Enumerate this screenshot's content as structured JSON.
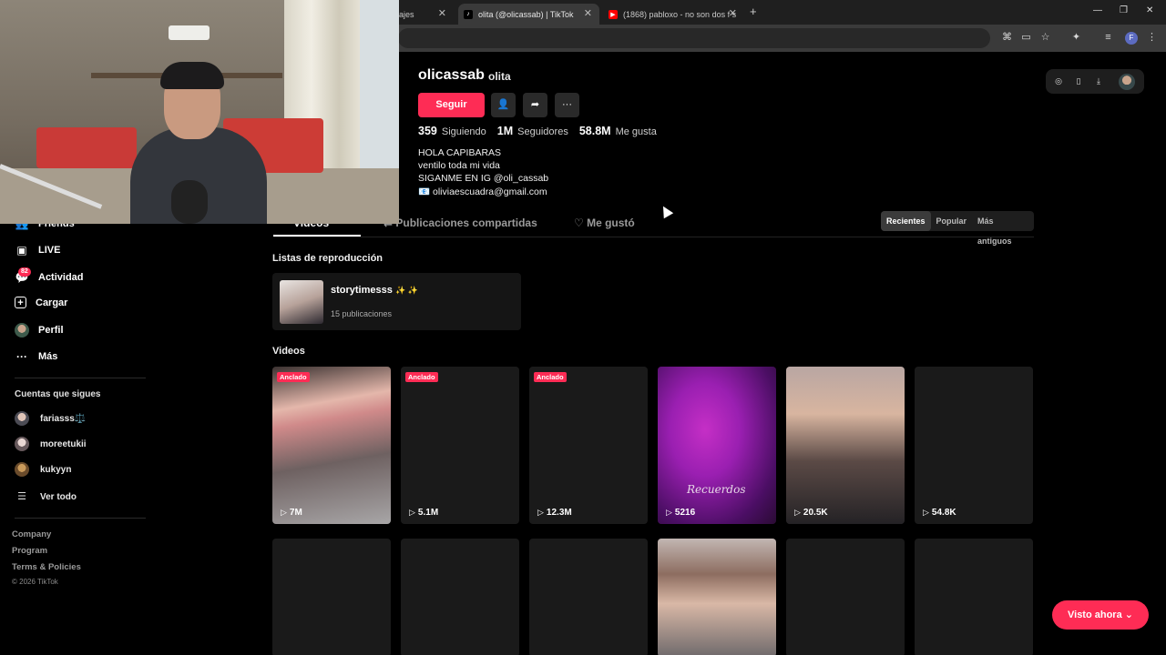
{
  "browser": {
    "tabs": [
      {
        "label": "ajes",
        "active": false
      },
      {
        "label": "olita (@olicassab) | TikTok",
        "active": true
      },
      {
        "label": "(1868) pabloxo - no son dos f s",
        "active": false
      }
    ],
    "close_glyph": "✕",
    "new_tab_glyph": "+"
  },
  "sidebar": {
    "items": [
      {
        "label": "Friends",
        "icon": "friends-icon"
      },
      {
        "label": "LIVE",
        "icon": "live-icon"
      },
      {
        "label": "Actividad",
        "icon": "activity-icon",
        "badge": "82"
      },
      {
        "label": "Cargar",
        "icon": "upload-icon"
      },
      {
        "label": "Perfil",
        "icon": "profile-avatar-icon"
      },
      {
        "label": "Más",
        "icon": "more-icon"
      }
    ],
    "following_heading": "Cuentas que sigues",
    "following": [
      {
        "name": "fariasss⚖️"
      },
      {
        "name": "moreetukii"
      },
      {
        "name": "kukyyn"
      }
    ],
    "see_all": "Ver todo",
    "footer_links": [
      "Company",
      "Program",
      "Terms & Policies"
    ],
    "copyright": "© 2026 TikTok"
  },
  "profile": {
    "username": "olicassab",
    "nickname": "olita",
    "follow_button": "Seguir",
    "stats": [
      {
        "value": "359",
        "label": "Siguiendo"
      },
      {
        "value": "1M",
        "label": "Seguidores"
      },
      {
        "value": "58.8M",
        "label": "Me gusta"
      }
    ],
    "bio": [
      "HOLA CAPIBARAS",
      "ventilo toda mi vida",
      "SIGANME EN IG @oli_cassab",
      "📧 oliviaescuadra@gmail.com"
    ]
  },
  "tabs": {
    "items": [
      "Videos",
      "Publicaciones compartidas",
      "Me gustó"
    ],
    "sort": [
      "Recientes",
      "Popular",
      "Más antiguos"
    ],
    "active_sort": "Recientes"
  },
  "playlists": {
    "heading": "Listas de reproducción",
    "items": [
      {
        "title": "storytimesss",
        "sparkles": "✨ ✨",
        "count": "15 publicaciones"
      }
    ]
  },
  "videos": {
    "heading": "Videos",
    "pinned_label": "Anclado",
    "row1": [
      {
        "views": "7M",
        "pinned": true
      },
      {
        "views": "5.1M",
        "pinned": true
      },
      {
        "views": "12.3M",
        "pinned": true
      },
      {
        "views": "5216",
        "pinned": false,
        "caption": "Recuerdos"
      },
      {
        "views": "20.5K",
        "pinned": false
      },
      {
        "views": "54.8K",
        "pinned": false
      }
    ]
  },
  "visto_button": "Visto ahora",
  "colors": {
    "accent": "#fe2c55",
    "background": "#000000",
    "card": "#1a1a1a"
  }
}
